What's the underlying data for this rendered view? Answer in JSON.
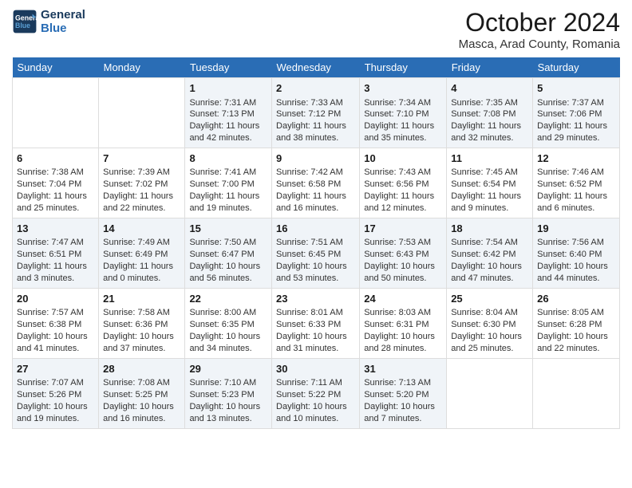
{
  "header": {
    "logo_line1": "General",
    "logo_line2": "Blue",
    "month_title": "October 2024",
    "subtitle": "Masca, Arad County, Romania"
  },
  "days_of_week": [
    "Sunday",
    "Monday",
    "Tuesday",
    "Wednesday",
    "Thursday",
    "Friday",
    "Saturday"
  ],
  "weeks": [
    [
      {
        "day": "",
        "info": ""
      },
      {
        "day": "",
        "info": ""
      },
      {
        "day": "1",
        "info": "Sunrise: 7:31 AM\nSunset: 7:13 PM\nDaylight: 11 hours and 42 minutes."
      },
      {
        "day": "2",
        "info": "Sunrise: 7:33 AM\nSunset: 7:12 PM\nDaylight: 11 hours and 38 minutes."
      },
      {
        "day": "3",
        "info": "Sunrise: 7:34 AM\nSunset: 7:10 PM\nDaylight: 11 hours and 35 minutes."
      },
      {
        "day": "4",
        "info": "Sunrise: 7:35 AM\nSunset: 7:08 PM\nDaylight: 11 hours and 32 minutes."
      },
      {
        "day": "5",
        "info": "Sunrise: 7:37 AM\nSunset: 7:06 PM\nDaylight: 11 hours and 29 minutes."
      }
    ],
    [
      {
        "day": "6",
        "info": "Sunrise: 7:38 AM\nSunset: 7:04 PM\nDaylight: 11 hours and 25 minutes."
      },
      {
        "day": "7",
        "info": "Sunrise: 7:39 AM\nSunset: 7:02 PM\nDaylight: 11 hours and 22 minutes."
      },
      {
        "day": "8",
        "info": "Sunrise: 7:41 AM\nSunset: 7:00 PM\nDaylight: 11 hours and 19 minutes."
      },
      {
        "day": "9",
        "info": "Sunrise: 7:42 AM\nSunset: 6:58 PM\nDaylight: 11 hours and 16 minutes."
      },
      {
        "day": "10",
        "info": "Sunrise: 7:43 AM\nSunset: 6:56 PM\nDaylight: 11 hours and 12 minutes."
      },
      {
        "day": "11",
        "info": "Sunrise: 7:45 AM\nSunset: 6:54 PM\nDaylight: 11 hours and 9 minutes."
      },
      {
        "day": "12",
        "info": "Sunrise: 7:46 AM\nSunset: 6:52 PM\nDaylight: 11 hours and 6 minutes."
      }
    ],
    [
      {
        "day": "13",
        "info": "Sunrise: 7:47 AM\nSunset: 6:51 PM\nDaylight: 11 hours and 3 minutes."
      },
      {
        "day": "14",
        "info": "Sunrise: 7:49 AM\nSunset: 6:49 PM\nDaylight: 11 hours and 0 minutes."
      },
      {
        "day": "15",
        "info": "Sunrise: 7:50 AM\nSunset: 6:47 PM\nDaylight: 10 hours and 56 minutes."
      },
      {
        "day": "16",
        "info": "Sunrise: 7:51 AM\nSunset: 6:45 PM\nDaylight: 10 hours and 53 minutes."
      },
      {
        "day": "17",
        "info": "Sunrise: 7:53 AM\nSunset: 6:43 PM\nDaylight: 10 hours and 50 minutes."
      },
      {
        "day": "18",
        "info": "Sunrise: 7:54 AM\nSunset: 6:42 PM\nDaylight: 10 hours and 47 minutes."
      },
      {
        "day": "19",
        "info": "Sunrise: 7:56 AM\nSunset: 6:40 PM\nDaylight: 10 hours and 44 minutes."
      }
    ],
    [
      {
        "day": "20",
        "info": "Sunrise: 7:57 AM\nSunset: 6:38 PM\nDaylight: 10 hours and 41 minutes."
      },
      {
        "day": "21",
        "info": "Sunrise: 7:58 AM\nSunset: 6:36 PM\nDaylight: 10 hours and 37 minutes."
      },
      {
        "day": "22",
        "info": "Sunrise: 8:00 AM\nSunset: 6:35 PM\nDaylight: 10 hours and 34 minutes."
      },
      {
        "day": "23",
        "info": "Sunrise: 8:01 AM\nSunset: 6:33 PM\nDaylight: 10 hours and 31 minutes."
      },
      {
        "day": "24",
        "info": "Sunrise: 8:03 AM\nSunset: 6:31 PM\nDaylight: 10 hours and 28 minutes."
      },
      {
        "day": "25",
        "info": "Sunrise: 8:04 AM\nSunset: 6:30 PM\nDaylight: 10 hours and 25 minutes."
      },
      {
        "day": "26",
        "info": "Sunrise: 8:05 AM\nSunset: 6:28 PM\nDaylight: 10 hours and 22 minutes."
      }
    ],
    [
      {
        "day": "27",
        "info": "Sunrise: 7:07 AM\nSunset: 5:26 PM\nDaylight: 10 hours and 19 minutes."
      },
      {
        "day": "28",
        "info": "Sunrise: 7:08 AM\nSunset: 5:25 PM\nDaylight: 10 hours and 16 minutes."
      },
      {
        "day": "29",
        "info": "Sunrise: 7:10 AM\nSunset: 5:23 PM\nDaylight: 10 hours and 13 minutes."
      },
      {
        "day": "30",
        "info": "Sunrise: 7:11 AM\nSunset: 5:22 PM\nDaylight: 10 hours and 10 minutes."
      },
      {
        "day": "31",
        "info": "Sunrise: 7:13 AM\nSunset: 5:20 PM\nDaylight: 10 hours and 7 minutes."
      },
      {
        "day": "",
        "info": ""
      },
      {
        "day": "",
        "info": ""
      }
    ]
  ]
}
